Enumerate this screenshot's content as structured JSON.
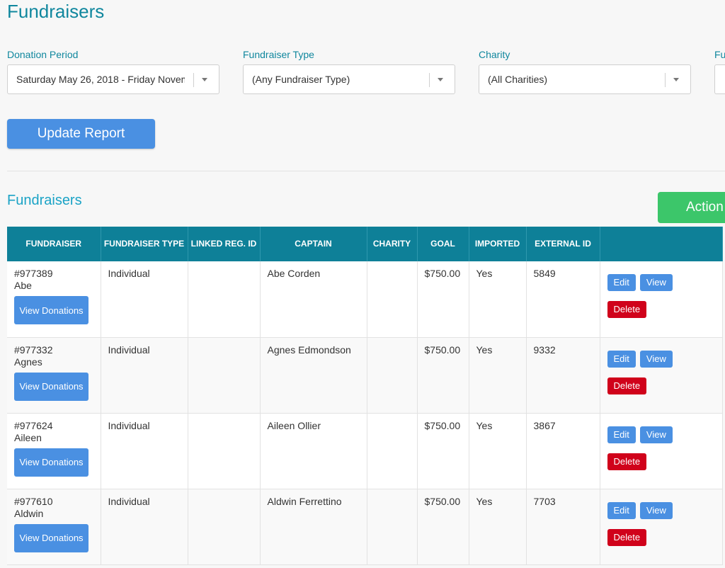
{
  "page": {
    "title": "Fundraisers"
  },
  "filters": [
    {
      "label": "Donation Period",
      "value": "Saturday May 26, 2018 - Friday Novem"
    },
    {
      "label": "Fundraiser Type",
      "value": "(Any Fundraiser Type)"
    },
    {
      "label": "Charity",
      "value": "(All Charities)"
    },
    {
      "label": "Fu",
      "value": ""
    }
  ],
  "update_button": "Update Report",
  "section": {
    "title": "Fundraisers",
    "actions_label": "Action"
  },
  "table": {
    "headers": [
      "FUNDRAISER",
      "FUNDRAISER TYPE",
      "LINKED REG. ID",
      "CAPTAIN",
      "CHARITY",
      "GOAL",
      "IMPORTED",
      "EXTERNAL ID",
      ""
    ],
    "view_donations_label": "View Donations",
    "edit_label": "Edit",
    "view_label": "View",
    "delete_label": "Delete",
    "rows": [
      {
        "id": "#977389",
        "name": "Abe",
        "type": "Individual",
        "linked_reg_id": "",
        "captain": "Abe Corden",
        "charity": "",
        "goal": "$750.00",
        "imported": "Yes",
        "external_id": "5849"
      },
      {
        "id": "#977332",
        "name": "Agnes",
        "type": "Individual",
        "linked_reg_id": "",
        "captain": "Agnes Edmondson",
        "charity": "",
        "goal": "$750.00",
        "imported": "Yes",
        "external_id": "9332"
      },
      {
        "id": "#977624",
        "name": "Aileen",
        "type": "Individual",
        "linked_reg_id": "",
        "captain": "Aileen Ollier",
        "charity": "",
        "goal": "$750.00",
        "imported": "Yes",
        "external_id": "3867"
      },
      {
        "id": "#977610",
        "name": "Aldwin",
        "type": "Individual",
        "linked_reg_id": "",
        "captain": "Aldwin Ferrettino",
        "charity": "",
        "goal": "$750.00",
        "imported": "Yes",
        "external_id": "7703"
      }
    ]
  },
  "colors": {
    "brand_teal": "#10879e",
    "header_bg": "#0e8098",
    "primary_button": "#4a90e2",
    "actions_button": "#3cc66a",
    "delete_button": "#d0021b"
  }
}
